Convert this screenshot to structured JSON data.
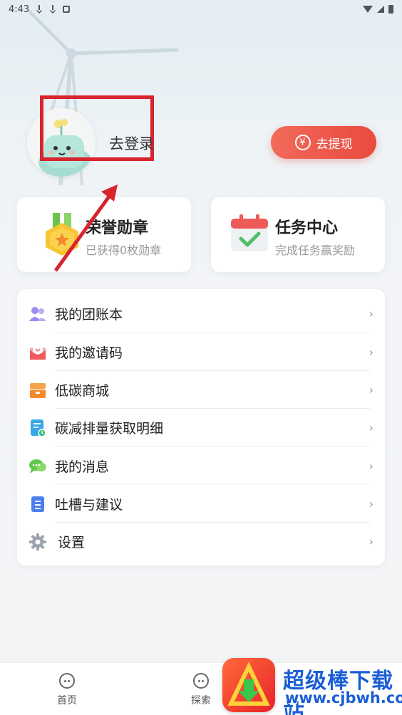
{
  "status_bar": {
    "time": "4:43"
  },
  "profile": {
    "login_text": "去登录",
    "withdraw_label": "去提现",
    "withdraw_icon": "yen-icon"
  },
  "cards": {
    "honor": {
      "title": "荣誉勋章",
      "subtitle": "已获得0枚勋章",
      "icon": "medal-icon"
    },
    "task": {
      "title": "任务中心",
      "subtitle": "完成任务赢奖励",
      "icon": "calendar-icon"
    }
  },
  "menu": [
    {
      "label": "我的团账本",
      "icon": "team-icon"
    },
    {
      "label": "我的邀请码",
      "icon": "envelope-icon"
    },
    {
      "label": "低碳商城",
      "icon": "store-icon"
    },
    {
      "label": "碳减排量获取明细",
      "icon": "document-clock-icon"
    },
    {
      "label": "我的消息",
      "icon": "chat-icon"
    },
    {
      "label": "吐槽与建议",
      "icon": "note-icon"
    },
    {
      "label": "设置",
      "icon": "gear-icon"
    }
  ],
  "menu_chevron": "›",
  "bottom_nav": [
    {
      "label": "首页",
      "icon": "home-face-icon"
    },
    {
      "label": "探索",
      "icon": "explore-face-icon"
    }
  ],
  "watermark": {
    "title": "超级棒下载站",
    "url": "www.cjbwh.com"
  },
  "colors": {
    "accent": "#e94a3f",
    "annotation": "#d9232d"
  }
}
